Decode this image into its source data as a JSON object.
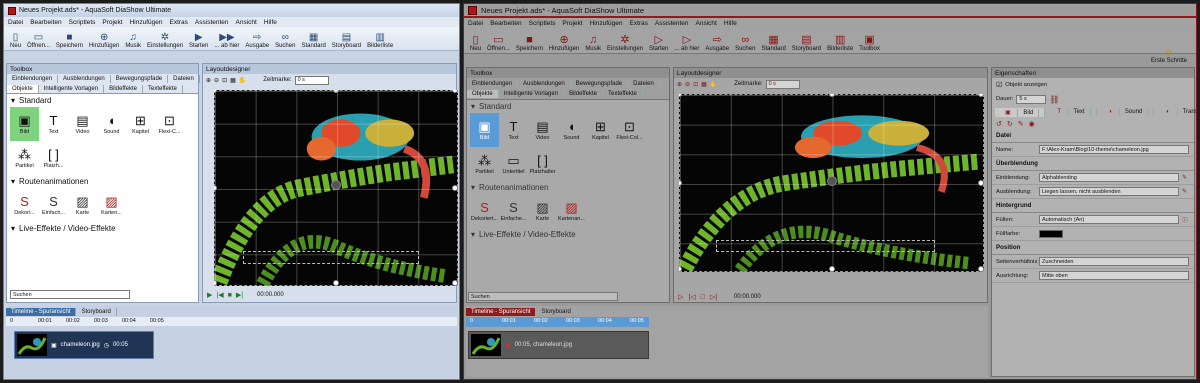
{
  "left": {
    "title": "Neues Projekt.ads* - AquaSoft DiaShow Ultimate",
    "menu": [
      "Datei",
      "Bearbeiten",
      "Scriptlets",
      "Projekt",
      "Hinzufügen",
      "Extras",
      "Assistenten",
      "Ansicht",
      "Hilfe"
    ],
    "ribbon": [
      {
        "label": "Neu",
        "icon": "new-doc-icon",
        "glyph": "▯"
      },
      {
        "label": "Öffnen...",
        "icon": "folder-open-icon",
        "glyph": "▭"
      },
      {
        "label": "Speichern",
        "icon": "save-icon",
        "glyph": "■"
      },
      {
        "label": "Hinzufügen",
        "icon": "add-icon",
        "glyph": "⊕"
      },
      {
        "label": "Musik",
        "icon": "music-icon",
        "glyph": "♫"
      },
      {
        "label": "Einstellungen",
        "icon": "settings-gear-icon",
        "glyph": "✲"
      },
      {
        "label": "Starten",
        "icon": "play-icon",
        "glyph": "▶"
      },
      {
        "label": "... ab hier",
        "icon": "play-from-here-icon",
        "glyph": "▶▶"
      },
      {
        "label": "Ausgabe",
        "icon": "output-icon",
        "glyph": "⇨"
      },
      {
        "label": "Suchen",
        "icon": "search-binoculars-icon",
        "glyph": "∞"
      },
      {
        "label": "Standard",
        "icon": "standard-layout-icon",
        "glyph": "▦"
      },
      {
        "label": "Storyboard",
        "icon": "storyboard-icon",
        "glyph": "▤"
      },
      {
        "label": "Bilderliste",
        "icon": "image-list-icon",
        "glyph": "▥"
      }
    ],
    "toolbox_title": "Toolbox",
    "tabs_row1": [
      "Einblendungen",
      "Ausblendungen",
      "Bewegungspfade",
      "Dateien"
    ],
    "tabs_row2": [
      "Objekte",
      "Intelligente Vorlagen",
      "Bildeffekte",
      "Texteffekte"
    ],
    "sec_standard": "Standard",
    "objects": [
      {
        "label": "Bild",
        "icon": "image-icon",
        "glyph": "▣"
      },
      {
        "label": "Text",
        "icon": "text-icon",
        "glyph": "T"
      },
      {
        "label": "Video",
        "icon": "video-icon",
        "glyph": "▤"
      },
      {
        "label": "Sound",
        "icon": "sound-icon",
        "glyph": "◖"
      },
      {
        "label": "Kapitel",
        "icon": "chapter-icon",
        "glyph": "⊞"
      },
      {
        "label": "Flexi-C...",
        "icon": "flexi-collage-icon",
        "glyph": "⊡"
      },
      {
        "label": "Partikel",
        "icon": "particle-icon",
        "glyph": "⁂"
      },
      {
        "label": "Platzh...",
        "icon": "placeholder-icon",
        "glyph": "[ ]"
      }
    ],
    "sec_routes": "Routenanimationen",
    "routes": [
      {
        "label": "Dekori...",
        "icon": "route-decorative-icon",
        "glyph": "S"
      },
      {
        "label": "Einfach...",
        "icon": "route-simple-icon",
        "glyph": "S"
      },
      {
        "label": "Karte",
        "icon": "map-icon",
        "glyph": "▨"
      },
      {
        "label": "Karten...",
        "icon": "map-red-icon",
        "glyph": "▨"
      }
    ],
    "sec_live": "Live-Effekte / Video-Effekte",
    "search_placeholder": "Suchen",
    "layout_title": "Layoutdesigner",
    "zeitmarke_label": "Zeitmarke:",
    "zeitmarke_value": "0 s",
    "time": "00:00.000",
    "timeline_tabs": [
      "Timeline - Spuransicht",
      "Storyboard"
    ],
    "ruler": [
      "0",
      "00:01",
      "00:02",
      "00:03",
      "00:04",
      "00:05"
    ],
    "clip_name": "chameleon.jpg",
    "clip_duration": "00:05"
  },
  "right": {
    "title": "Neues Projekt.ads* - AquaSoft DiaShow Ultimate",
    "menu": [
      "Datei",
      "Bearbeiten",
      "Scriptlets",
      "Projekt",
      "Hinzufügen",
      "Extras",
      "Assistenten",
      "Ansicht",
      "Hilfe"
    ],
    "ribbon": [
      {
        "label": "Neu",
        "icon": "new-doc-icon",
        "glyph": "▯"
      },
      {
        "label": "Öffnen...",
        "icon": "folder-open-icon",
        "glyph": "▭"
      },
      {
        "label": "Speichern",
        "icon": "save-icon",
        "glyph": "■"
      },
      {
        "label": "Hinzufügen",
        "icon": "add-icon",
        "glyph": "⊕"
      },
      {
        "label": "Musik",
        "icon": "music-icon",
        "glyph": "♫"
      },
      {
        "label": "Einstellungen",
        "icon": "settings-gear-icon",
        "glyph": "✲"
      },
      {
        "label": "Starten",
        "icon": "play-icon",
        "glyph": "▷"
      },
      {
        "label": "... ab hier",
        "icon": "play-from-here-icon",
        "glyph": "▷"
      },
      {
        "label": "Ausgabe",
        "icon": "output-icon",
        "glyph": "⇨"
      },
      {
        "label": "Suchen",
        "icon": "search-binoculars-icon",
        "glyph": "∞"
      },
      {
        "label": "Standard",
        "icon": "standard-layout-icon",
        "glyph": "▦"
      },
      {
        "label": "Storyboard",
        "icon": "storyboard-icon",
        "glyph": "▤"
      },
      {
        "label": "Bilderliste",
        "icon": "image-list-icon",
        "glyph": "▥"
      },
      {
        "label": "Toolbox",
        "icon": "toolbox-icon",
        "glyph": "▣"
      }
    ],
    "erste_schritte": "Erste Schritte",
    "toolbox_title": "Toolbox",
    "tabs_row1": [
      "Einblendungen",
      "Ausblendungen",
      "Bewegungspfade",
      "Dateien"
    ],
    "tabs_row2": [
      "Objekte",
      "Intelligente Vorlagen",
      "Bildeffekte",
      "Texteffekte"
    ],
    "sec_standard": "Standard",
    "objects": [
      {
        "label": "Bild",
        "icon": "image-icon",
        "glyph": "▣"
      },
      {
        "label": "Text",
        "icon": "text-icon",
        "glyph": "T"
      },
      {
        "label": "Video",
        "icon": "video-icon",
        "glyph": "▤"
      },
      {
        "label": "Sound",
        "icon": "sound-icon",
        "glyph": "◖"
      },
      {
        "label": "Kapitel",
        "icon": "chapter-icon",
        "glyph": "⊞"
      },
      {
        "label": "Flexi-Col...",
        "icon": "flexi-collage-icon",
        "glyph": "⊡"
      },
      {
        "label": "Partikel",
        "icon": "particle-icon",
        "glyph": "⁂"
      },
      {
        "label": "Untertitel",
        "icon": "subtitle-icon",
        "glyph": "▭"
      },
      {
        "label": "Platzhalter",
        "icon": "placeholder-icon",
        "glyph": "[ ]"
      }
    ],
    "sec_routes": "Routenanimationen",
    "routes": [
      {
        "label": "Dekoriert...",
        "icon": "route-decorative-icon",
        "glyph": "S"
      },
      {
        "label": "Einfache...",
        "icon": "route-simple-icon",
        "glyph": "S"
      },
      {
        "label": "Karte",
        "icon": "map-icon",
        "glyph": "▨"
      },
      {
        "label": "Kartenan...",
        "icon": "map-red-icon",
        "glyph": "▨"
      }
    ],
    "sec_live": "Live-Effekte / Video-Effekte",
    "search_placeholder": "Suchen",
    "layout_title": "Layoutdesigner",
    "zeitmarke_label": "Zeitmarke:",
    "zeitmarke_value": "0 s",
    "time": "00:00.000",
    "props": {
      "title": "Eigenschaften",
      "show_object": "Objekt anzeigen",
      "dauer_label": "Dauer:",
      "dauer_value": "5 s",
      "tabs": [
        "Bild",
        "Text",
        "Sound",
        "Transparenz"
      ],
      "sec_datei": "Datei",
      "name_label": "Name:",
      "name_value": "F:\\Alex-Kram\\Blog\\10-theme\\chameleon.jpg",
      "sec_ueberblendung": "Überblendung",
      "einblendung_label": "Einblendung:",
      "einblendung_value": "Alphablending",
      "ausblendung_label": "Ausblendung:",
      "ausblendung_value": "Liegen lassen, nicht ausblenden",
      "sec_hintergrund": "Hintergrund",
      "fuellen_label": "Füllen:",
      "fuellen_value": "Automatisch (An)",
      "fuellfarbe_label": "Füllfarbe:",
      "sec_position": "Position",
      "seiten_label": "Seitenverhältnis:",
      "seiten_value": "Zuschneiden",
      "ausrichtung_label": "Ausrichtung:",
      "ausrichtung_value": "Mitte oben"
    },
    "timeline_tabs": [
      "Timeline - Spuransicht",
      "Storyboard"
    ],
    "ruler": [
      "0",
      "00:01",
      "00:02",
      "00:03",
      "00:04",
      "00:05"
    ],
    "clip_text": "00:05, chameleon.jpg"
  },
  "colors": {
    "accent_red": "#8d1c1c",
    "selection_blue": "#5b9bd5",
    "stage_bg": "#000000"
  }
}
